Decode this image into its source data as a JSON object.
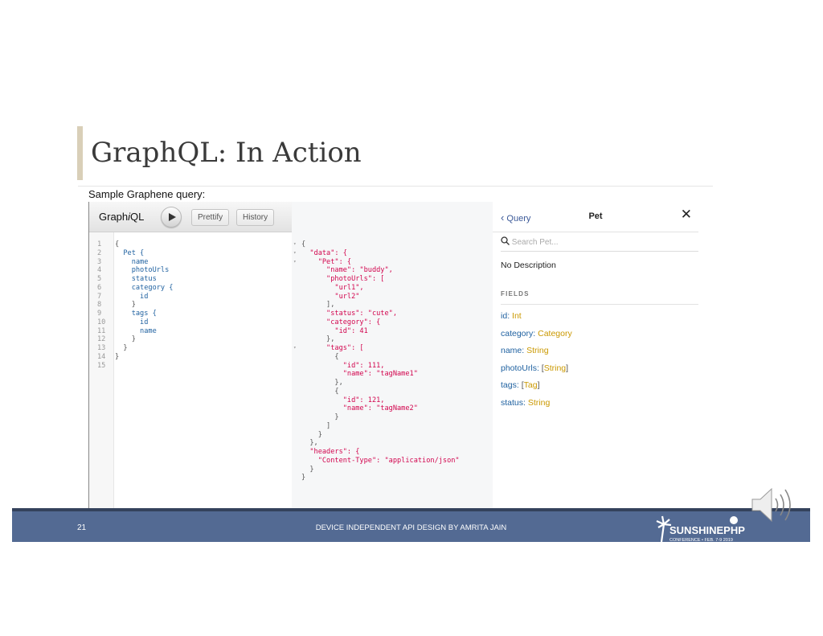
{
  "slide": {
    "title": "GraphQL: In Action",
    "subtitle": "Sample Graphene query:",
    "page_number": "21",
    "footer_text": "DEVICE INDEPENDENT API DESIGN BY AMRITA JAIN",
    "conference_logo_text": "SunshinePHP Conference • FEB. 7-9 2019"
  },
  "graphiql": {
    "logo": {
      "pre": "Graph",
      "i": "i",
      "post": "QL"
    },
    "prettify_label": "Prettify",
    "history_label": "History",
    "line_numbers": [
      "1",
      "2",
      "3",
      "4",
      "5",
      "6",
      "7",
      "8",
      "9",
      "10",
      "11",
      "12",
      "13",
      "14",
      "15"
    ],
    "query_lines": [
      "{",
      "  Pet {",
      "    name",
      "    photoUrls",
      "    status",
      "    category {",
      "      id",
      "    }",
      "    tags {",
      "      id",
      "      name",
      "    }",
      "  }",
      "}",
      ""
    ],
    "result_lines": [
      "{",
      "  \"data\": {",
      "    \"Pet\": {",
      "      \"name\": \"buddy\",",
      "      \"photoUrls\": [",
      "        \"url1\",",
      "        \"url2\"",
      "      ],",
      "      \"status\": \"cute\",",
      "      \"category\": {",
      "        \"id\": 41",
      "      },",
      "      \"tags\": [",
      "        {",
      "          \"id\": 111,",
      "          \"name\": \"tagName1\"",
      "        },",
      "        {",
      "          \"id\": 121,",
      "          \"name\": \"tagName2\"",
      "        }",
      "      ]",
      "    }",
      "  },",
      "  \"headers\": {",
      "    \"Content-Type\": \"application/json\"",
      "  }",
      "}"
    ],
    "docs": {
      "back_label": "Query",
      "title": "Pet",
      "search_placeholder": "Search Pet...",
      "description": "No Description",
      "fields_heading": "FIELDS",
      "fields": [
        {
          "name": "id",
          "type": "Int",
          "list": false
        },
        {
          "name": "category",
          "type": "Category",
          "list": false
        },
        {
          "name": "name",
          "type": "String",
          "list": false
        },
        {
          "name": "photoUrls",
          "type": "String",
          "list": true
        },
        {
          "name": "tags",
          "type": "Tag",
          "list": true
        },
        {
          "name": "status",
          "type": "String",
          "list": false
        }
      ]
    }
  },
  "colors": {
    "footer": "#536a93",
    "string": "#d2054e",
    "number": "#2882f9",
    "field": "#1f61a0",
    "type": "#ca9800"
  }
}
